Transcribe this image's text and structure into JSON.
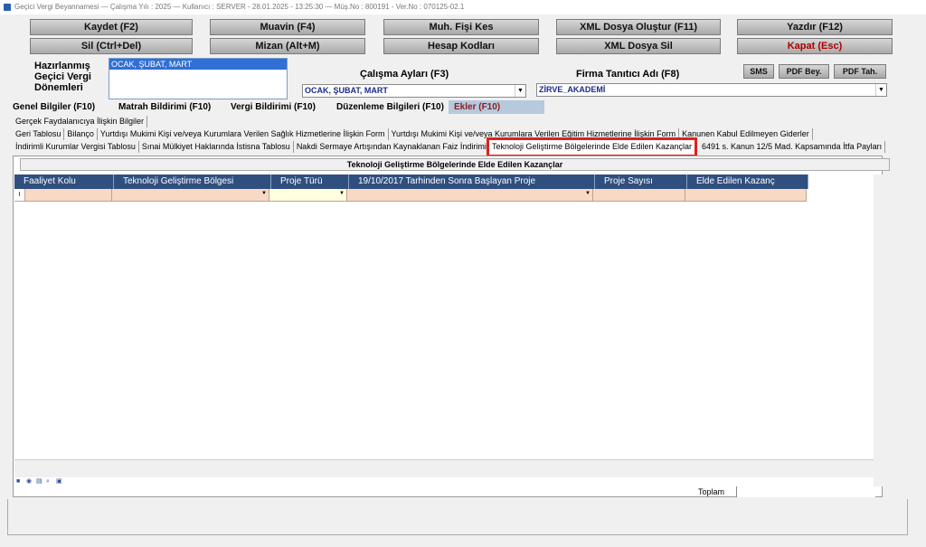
{
  "window": {
    "title": "Geçici Vergi Beyannamesi  —  Çalışma Yılı : 2025  —  Kullanıcı : SERVER - 28.01.2025 - 13:25:30  —  Müş.No : 800191  - Ver.No : 070125-02.1"
  },
  "toolbar": {
    "row1": [
      "Kaydet (F2)",
      "Muavin (F4)",
      "Muh. Fişi Kes",
      "XML Dosya Oluştur (F11)",
      "Yazdır (F12)"
    ],
    "row2": [
      "Sil (Ctrl+Del)",
      "Mizan (Alt+M)",
      "Hesap Kodları",
      "XML Dosya Sil",
      "Kapat (Esc)"
    ]
  },
  "periods": {
    "label_line1": "Hazırlanmış",
    "label_line2": "Geçici Vergi",
    "label_line3": "Dönemleri",
    "selected": "OCAK, ŞUBAT, MART"
  },
  "work_months": {
    "label": "Çalışma Ayları (F3)",
    "value": "OCAK, ŞUBAT, MART"
  },
  "firm": {
    "label": "Firma Tanıtıcı Adı (F8)",
    "value": "ZİRVE_AKADEMİ"
  },
  "side_buttons": [
    "SMS",
    "PDF Bey.",
    "PDF Tah."
  ],
  "main_tabs": [
    "Genel Bilgiler (F10)",
    "Matrah Bildirimi (F10)",
    "Vergi Bildirimi (F10)",
    "Düzenleme Bilgileri (F10)",
    "Ekler (F10)"
  ],
  "sub_tabs_row1": [
    "Gerçek Faydalanıcıya İlişkin Bilgiler"
  ],
  "sub_tabs_row2": [
    "Geri Tablosu",
    "Bilanço",
    "Yurtdışı Mukimi Kişi ve/veya Kurumlara Verilen Sağlık Hizmetlerine İlişkin Form",
    "Yurtdışı Mukimi Kişi ve/veya Kurumlara Verilen Eğitim Hizmetlerine İlişkin Form",
    "Kanunen Kabul Edilmeyen Giderler"
  ],
  "sub_tabs_row3": [
    "İndirimli Kurumlar Vergisi Tablosu",
    "Sınai Mülkiyet Haklarında İstisna Tablosu",
    "Nakdi Sermaye Artışından Kaynaklanan Faiz İndirimi"
  ],
  "sub_tab_active": "Teknoloji Geliştirme Bölgelerinde Elde Edilen Kazançlar",
  "sub_tab_after": "6491 s. Kanun 12/5 Mad. Kapsamında İtfa Payları",
  "panel_title": "Teknoloji Geliştirme Bölgelerinde Elde Edilen Kazançlar",
  "grid": {
    "columns": [
      "Faaliyet Kolu",
      "Teknoloji Geliştirme Bölgesi",
      "Proje Türü",
      "19/10/2017 Tarhinden Sonra Başlayan Proje",
      "Proje Sayısı",
      "Elde Edilen Kazanç"
    ],
    "row_marker": "I"
  },
  "footer": {
    "total_label": "Toplam"
  }
}
